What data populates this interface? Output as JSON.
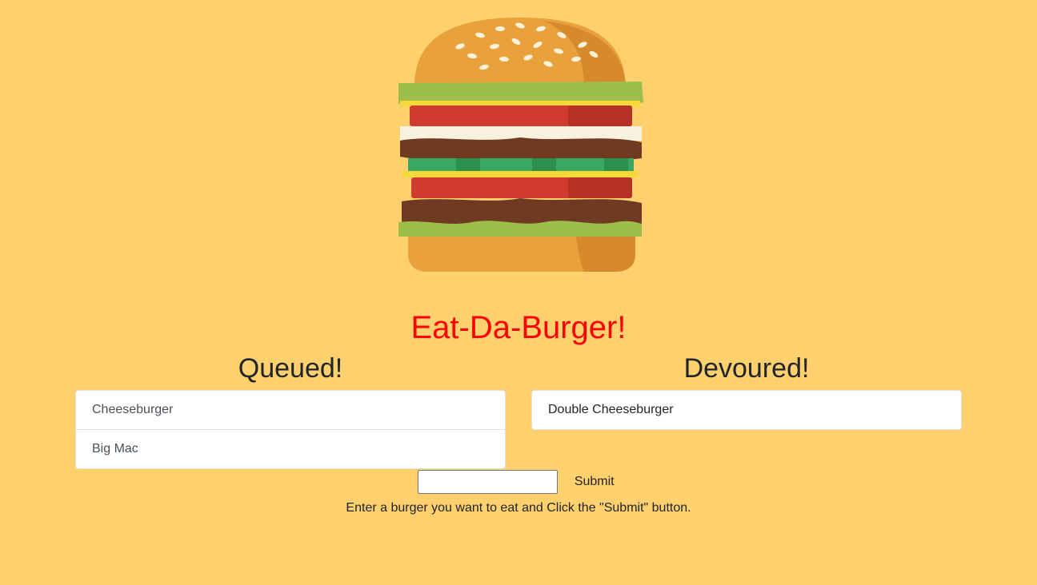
{
  "app": {
    "title": "Eat-Da-Burger!"
  },
  "hero_image": {
    "icon": "burger-illustration"
  },
  "queued": {
    "heading": "Queued!",
    "items": [
      "Cheeseburger",
      "Big Mac"
    ]
  },
  "devoured": {
    "heading": "Devoured!",
    "items": [
      "Double Cheeseburger"
    ]
  },
  "form": {
    "input_value": "",
    "submit_label": "Submit",
    "helper_text": "Enter a burger you want to eat and Click the \"Submit\" button."
  },
  "colors": {
    "background": "#ffd06e",
    "title": "#ff0000"
  }
}
